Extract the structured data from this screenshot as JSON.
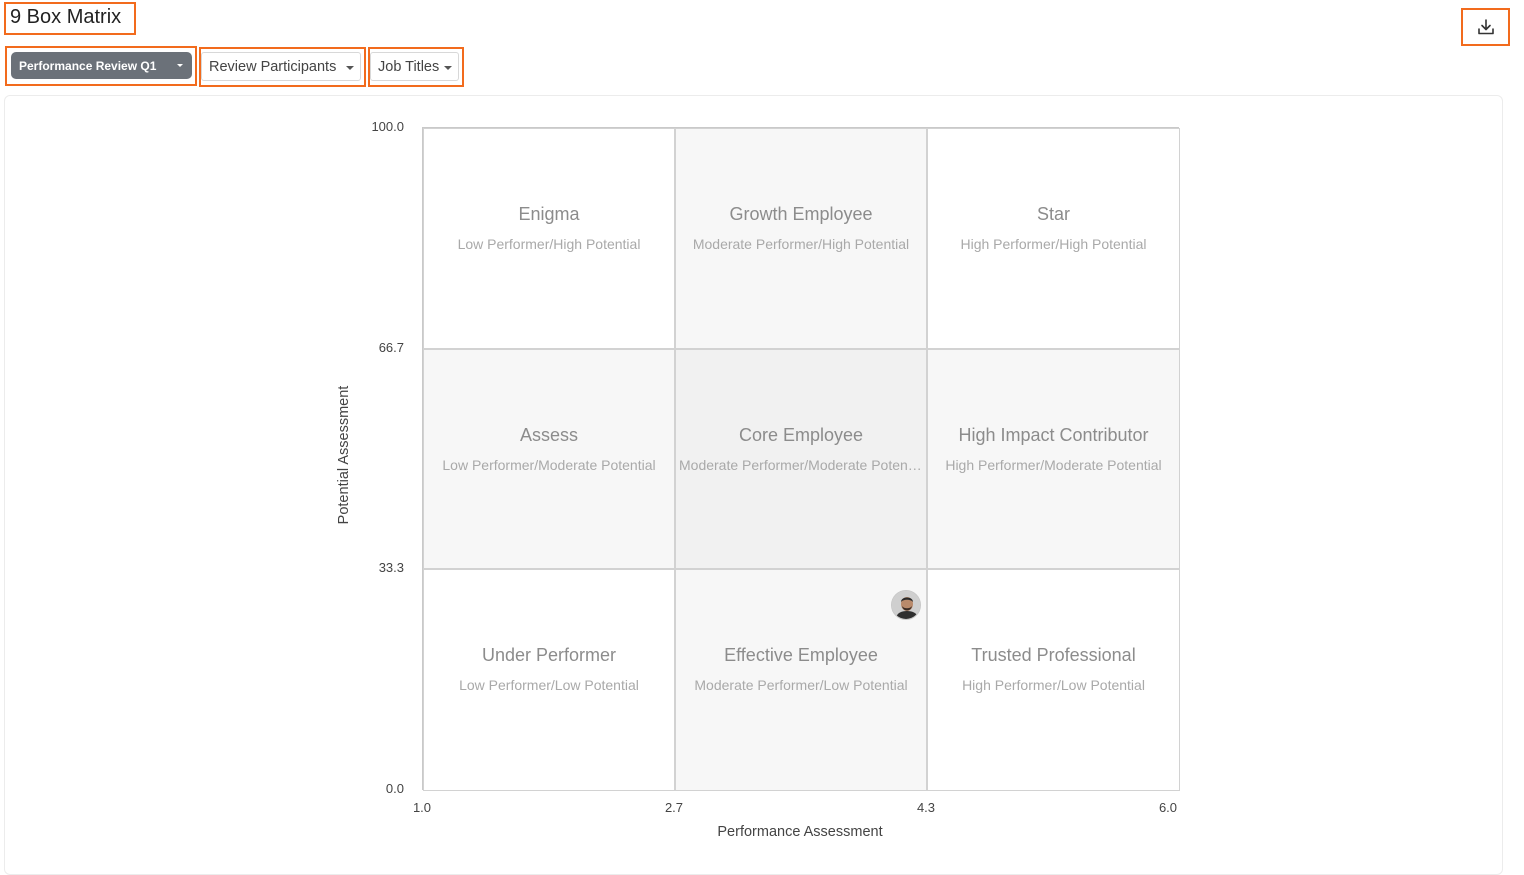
{
  "header": {
    "title": "9 Box Matrix",
    "download_icon": "download-icon"
  },
  "filters": {
    "review_cycle": "Performance Review Q1",
    "participants": "Review Participants",
    "job_titles": "Job Titles"
  },
  "colors": {
    "highlight": "#f26b1d",
    "dark_dropdown": "#6b7179",
    "cell_shade": "#f7f7f7",
    "cell_shade_center": "#f1f1f1"
  },
  "matrix": {
    "y_axis_label": "Potential Assessment",
    "x_axis_label": "Performance Assessment",
    "y_ticks": [
      "100.0",
      "66.7",
      "33.3",
      "0.0"
    ],
    "x_ticks": [
      "1.0",
      "2.7",
      "4.3",
      "6.0"
    ],
    "cells": [
      {
        "title": "Enigma",
        "subtitle": "Low Performer/High Potential"
      },
      {
        "title": "Growth Employee",
        "subtitle": "Moderate Performer/High Potential"
      },
      {
        "title": "Star",
        "subtitle": "High Performer/High Potential"
      },
      {
        "title": "Assess",
        "subtitle": "Low Performer/Moderate Potential"
      },
      {
        "title": "Core Employee",
        "subtitle": "Moderate Performer/Moderate Potential"
      },
      {
        "title": "High Impact Contributor",
        "subtitle": "High Performer/Moderate Potential"
      },
      {
        "title": "Under Performer",
        "subtitle": "Low Performer/Low Potential"
      },
      {
        "title": "Effective Employee",
        "subtitle": "Moderate Performer/Low Potential"
      },
      {
        "title": "Trusted Professional",
        "subtitle": "High Performer/Low Potential"
      }
    ]
  }
}
